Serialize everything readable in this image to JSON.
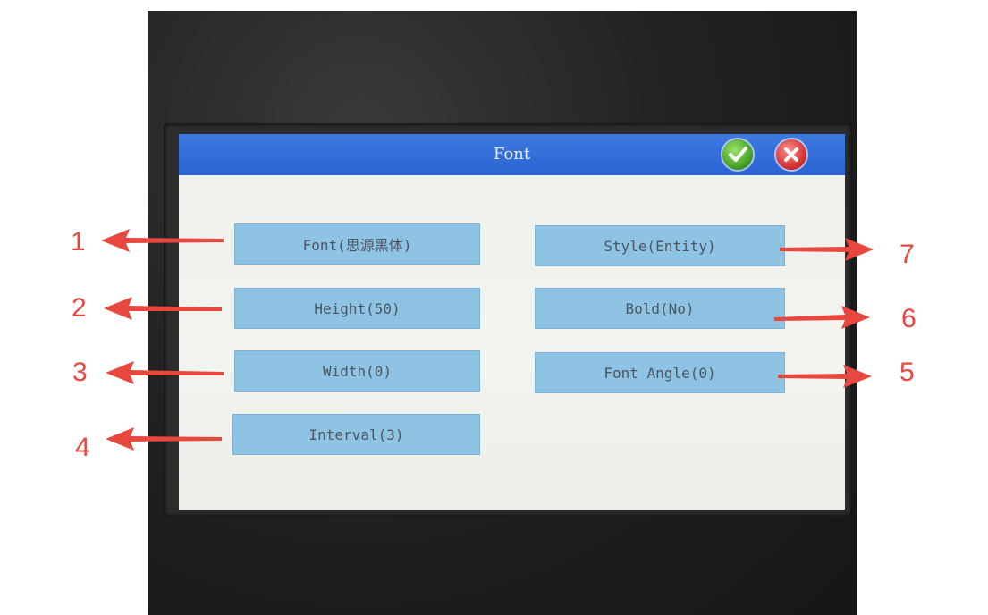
{
  "dialog": {
    "title": "Font",
    "confirm_icon": "check-icon",
    "close_icon": "close-icon"
  },
  "options": {
    "font": "Font(思源黑体)",
    "height": "Height(50)",
    "width": "Width(0)",
    "interval": "Interval(3)",
    "style": "Style(Entity)",
    "bold": "Bold(No)",
    "font_angle": "Font Angle(0)"
  },
  "callouts": [
    "1",
    "2",
    "3",
    "4",
    "5",
    "6",
    "7"
  ],
  "colors": {
    "titlebar": "#2b63d3",
    "option_button": "#8ec3e4",
    "callout": "#e8473f",
    "confirm": "#3f9a21",
    "close": "#d12a2a"
  }
}
